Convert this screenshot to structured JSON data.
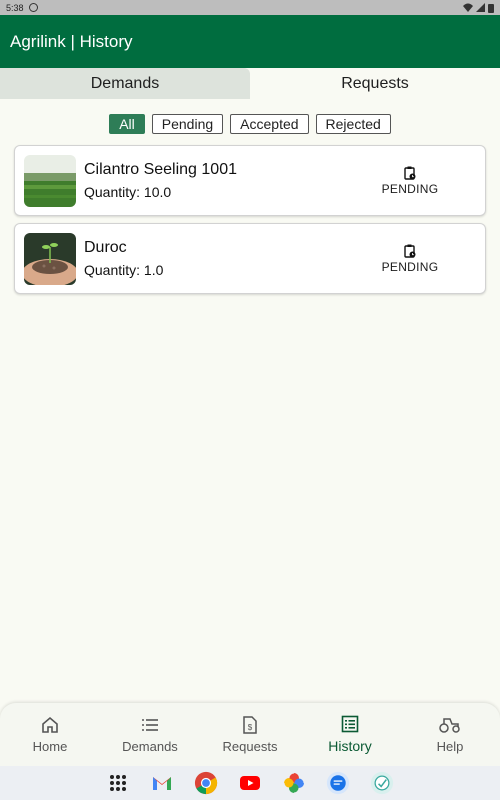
{
  "status_bar": {
    "time": "5:38"
  },
  "app_bar": {
    "title": "Agrilink | History"
  },
  "tabs": [
    {
      "label": "Demands",
      "active": false
    },
    {
      "label": "Requests",
      "active": true
    }
  ],
  "filters": [
    {
      "label": "All",
      "selected": true
    },
    {
      "label": "Pending",
      "selected": false
    },
    {
      "label": "Accepted",
      "selected": false
    },
    {
      "label": "Rejected",
      "selected": false
    }
  ],
  "requests": [
    {
      "title": "Cilantro Seeling 1001",
      "quantity": "Quantity: 10.0",
      "status": "PENDING",
      "thumb_icon": "field-landscape-image"
    },
    {
      "title": "Duroc",
      "quantity": "Quantity: 1.0",
      "status": "PENDING",
      "thumb_icon": "seedling-in-hands-image"
    }
  ],
  "bottom_nav": [
    {
      "label": "Home",
      "icon": "home-icon",
      "active": false
    },
    {
      "label": "Demands",
      "icon": "list-icon",
      "active": false
    },
    {
      "label": "Requests",
      "icon": "request-icon",
      "active": false
    },
    {
      "label": "History",
      "icon": "history-icon",
      "active": true
    },
    {
      "label": "Help",
      "icon": "tractor-icon",
      "active": false
    }
  ],
  "dock": [
    "apps-grid-icon",
    "gmail-icon",
    "chrome-icon",
    "youtube-icon",
    "photos-icon",
    "messages-icon",
    "assistant-app-icon"
  ],
  "colors": {
    "primary": "#006d3f",
    "chip_selected": "#2e7d57",
    "background": "#f9faf3"
  }
}
